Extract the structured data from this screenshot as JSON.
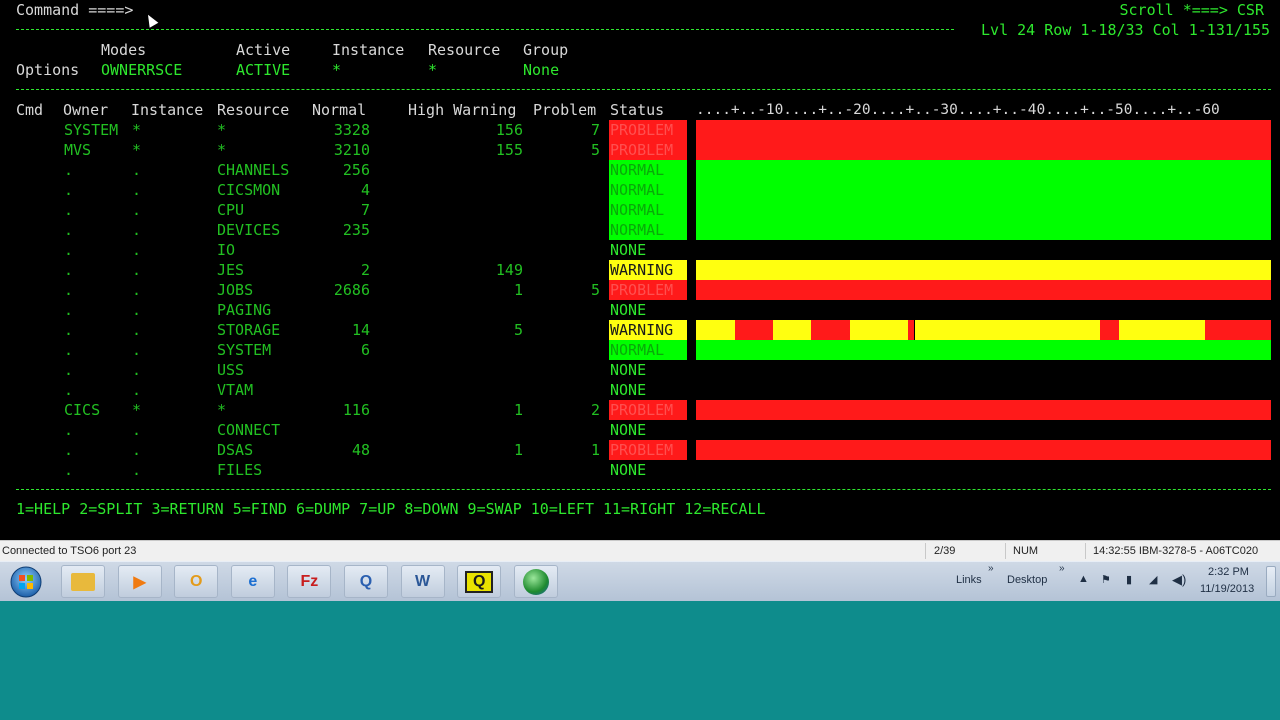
{
  "header": {
    "command_label": "Command ====>",
    "scroll_label": "Scroll *===> CSR",
    "position_info": "Lvl 24 Row 1-18/33 Col 1-131/155"
  },
  "options": {
    "row_label": "Options",
    "headers": {
      "modes": "Modes",
      "active": "Active",
      "instance": "Instance",
      "resource": "Resource",
      "group": "Group"
    },
    "values": {
      "modes": "OWNERRSCE",
      "active": "ACTIVE",
      "instance": "*",
      "resource": "*",
      "group": "None"
    }
  },
  "table": {
    "headers": {
      "cmd": "Cmd",
      "owner": "Owner",
      "instance": "Instance",
      "resource": "Resource",
      "normal": "Normal",
      "high_warning": "High Warning",
      "problem": "Problem",
      "status": "Status",
      "scale": "....+..-10....+..-20....+..-30....+..-40....+..-50....+..-60"
    },
    "rows": [
      {
        "owner": "SYSTEM",
        "instance": "*",
        "resource": "*",
        "normal": "3328",
        "high_warning": "156",
        "problem": "7",
        "status": "PROBLEM"
      },
      {
        "owner": "MVS",
        "instance": "*",
        "resource": "*",
        "normal": "3210",
        "high_warning": "155",
        "problem": "5",
        "status": "PROBLEM"
      },
      {
        "owner": ".",
        "instance": ".",
        "resource": "CHANNELS",
        "normal": "256",
        "high_warning": "",
        "problem": "",
        "status": "NORMAL"
      },
      {
        "owner": ".",
        "instance": ".",
        "resource": "CICSMON",
        "normal": "4",
        "high_warning": "",
        "problem": "",
        "status": "NORMAL"
      },
      {
        "owner": ".",
        "instance": ".",
        "resource": "CPU",
        "normal": "7",
        "high_warning": "",
        "problem": "",
        "status": "NORMAL"
      },
      {
        "owner": ".",
        "instance": ".",
        "resource": "DEVICES",
        "normal": "235",
        "high_warning": "",
        "problem": "",
        "status": "NORMAL"
      },
      {
        "owner": ".",
        "instance": ".",
        "resource": "IO",
        "normal": "",
        "high_warning": "",
        "problem": "",
        "status": "NONE"
      },
      {
        "owner": ".",
        "instance": ".",
        "resource": "JES",
        "normal": "2",
        "high_warning": "149",
        "problem": "",
        "status": "WARNING"
      },
      {
        "owner": ".",
        "instance": ".",
        "resource": "JOBS",
        "normal": "2686",
        "high_warning": "1",
        "problem": "5",
        "status": "PROBLEM"
      },
      {
        "owner": ".",
        "instance": ".",
        "resource": "PAGING",
        "normal": "",
        "high_warning": "",
        "problem": "",
        "status": "NONE"
      },
      {
        "owner": ".",
        "instance": ".",
        "resource": "STORAGE",
        "normal": "14",
        "high_warning": "5",
        "problem": "",
        "status": "WARNING"
      },
      {
        "owner": ".",
        "instance": ".",
        "resource": "SYSTEM",
        "normal": "6",
        "high_warning": "",
        "problem": "",
        "status": "NORMAL"
      },
      {
        "owner": ".",
        "instance": ".",
        "resource": "USS",
        "normal": "",
        "high_warning": "",
        "problem": "",
        "status": "NONE"
      },
      {
        "owner": ".",
        "instance": ".",
        "resource": "VTAM",
        "normal": "",
        "high_warning": "",
        "problem": "",
        "status": "NONE"
      },
      {
        "owner": "CICS",
        "instance": "*",
        "resource": "*",
        "normal": "116",
        "high_warning": "1",
        "problem": "2",
        "status": "PROBLEM"
      },
      {
        "owner": ".",
        "instance": ".",
        "resource": "CONNECT",
        "normal": "",
        "high_warning": "",
        "problem": "",
        "status": "NONE"
      },
      {
        "owner": ".",
        "instance": ".",
        "resource": "DSAS",
        "normal": "48",
        "high_warning": "1",
        "problem": "1",
        "status": "PROBLEM"
      },
      {
        "owner": ".",
        "instance": ".",
        "resource": "FILES",
        "normal": "",
        "high_warning": "",
        "problem": "",
        "status": "NONE"
      }
    ],
    "storage_bar_segments": [
      "W",
      "P",
      "W",
      "P",
      "W",
      "P",
      "W",
      "P",
      "W",
      "P"
    ]
  },
  "pfkeys": "1=HELP 2=SPLIT 3=RETURN 5=FIND 6=DUMP 7=UP 8=DOWN 9=SWAP 10=LEFT 11=RIGHT 12=RECALL",
  "status_bar": {
    "connection": "Connected to TSO6 port 23",
    "cursor_pos": "2/39",
    "num_lock": "NUM",
    "session": "14:32:55 IBM-3278-5 - A06TC020"
  },
  "taskbar": {
    "apps": [
      {
        "name": "file-explorer",
        "glyph": ""
      },
      {
        "name": "media-player",
        "glyph": "▶"
      },
      {
        "name": "outlook",
        "glyph": "O"
      },
      {
        "name": "internet-explorer",
        "glyph": "e"
      },
      {
        "name": "filezilla",
        "glyph": "Fz"
      },
      {
        "name": "remote-client",
        "glyph": "Q"
      },
      {
        "name": "word",
        "glyph": "W"
      },
      {
        "name": "terminal-emulator",
        "glyph": "Q"
      },
      {
        "name": "globe",
        "glyph": ""
      }
    ],
    "links_label": "Links",
    "desktop_label": "Desktop",
    "clock_time": "2:32 PM",
    "clock_date": "11/19/2013"
  },
  "colors": {
    "problem": "#ff1a1a",
    "normal": "#00ff00",
    "warning": "#ffff10",
    "terminal_text": "#2ee82e",
    "desktop": "#0e8c8c"
  }
}
